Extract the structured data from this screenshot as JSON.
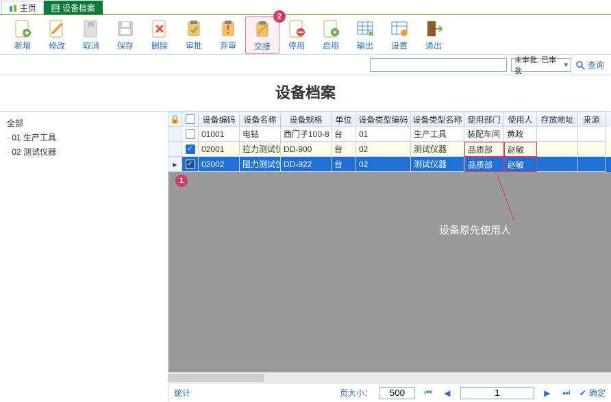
{
  "tabs": {
    "home": "主页",
    "active": "设备档案"
  },
  "toolbar": [
    {
      "key": "new",
      "label": "新增"
    },
    {
      "key": "edit",
      "label": "修改"
    },
    {
      "key": "cancel",
      "label": "取消"
    },
    {
      "key": "save",
      "label": "保存"
    },
    {
      "key": "delete",
      "label": "删除"
    },
    {
      "key": "approve",
      "label": "审批"
    },
    {
      "key": "abandon",
      "label": "弃审"
    },
    {
      "key": "handover",
      "label": "交接"
    },
    {
      "key": "disable",
      "label": "停用"
    },
    {
      "key": "enable",
      "label": "启用"
    },
    {
      "key": "export",
      "label": "输出"
    },
    {
      "key": "settings",
      "label": "设置"
    },
    {
      "key": "exit",
      "label": "退出"
    }
  ],
  "filter": {
    "status_text": "未审批, 已审批",
    "search_label": "查询"
  },
  "heading": "设备档案",
  "tree": [
    {
      "label": "全部",
      "level": 0
    },
    {
      "label": "01 生产工具",
      "level": 1
    },
    {
      "label": "02 测试仪器",
      "level": 1
    }
  ],
  "columns": [
    "设备编码",
    "设备名称",
    "设备规格",
    "单位",
    "设备类型编码",
    "设备类型名称",
    "使用部门",
    "使用人",
    "存放地址",
    "来源"
  ],
  "lock_icon": "🔒",
  "rows": [
    {
      "checked": false,
      "cells": [
        "01001",
        "电钻",
        "西门子100-8",
        "台",
        "01",
        "生产工具",
        "装配车间",
        "黄政",
        "",
        ""
      ]
    },
    {
      "checked": true,
      "cells": [
        "02001",
        "拉力测试仪",
        "DD-900",
        "台",
        "02",
        "测试仪器",
        "品质部",
        "赵敏",
        "",
        ""
      ]
    },
    {
      "checked": true,
      "selected": true,
      "cells": [
        "02002",
        "阻力测试仪",
        "DD-922",
        "台",
        "02",
        "测试仪器",
        "品质部",
        "赵敏",
        "",
        ""
      ]
    }
  ],
  "pager": {
    "stats": "统计",
    "page_size_label": "页大小：",
    "page_size": "500",
    "page": "1",
    "ok": "确定"
  },
  "annot": {
    "badge1": "1",
    "badge2": "2",
    "text": "设备原先使用人"
  }
}
